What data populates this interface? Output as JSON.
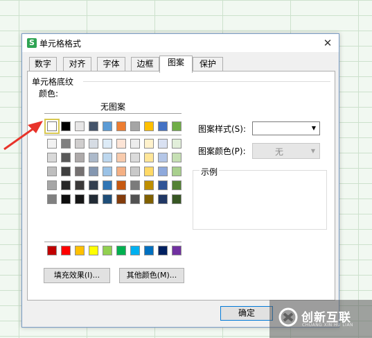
{
  "dialog": {
    "title": "单元格格式",
    "app_icon": "S",
    "close_glyph": "✕"
  },
  "tabs": [
    {
      "label": "数字",
      "active": false
    },
    {
      "label": "对齐",
      "active": false
    },
    {
      "label": "字体",
      "active": false
    },
    {
      "label": "边框",
      "active": false
    },
    {
      "label": "图案",
      "active": true
    },
    {
      "label": "保护",
      "active": false
    }
  ],
  "shading": {
    "section_title": "单元格底纹",
    "color_label": "颜色:",
    "no_pattern_label": "无图案",
    "palette_row1": [
      "#ffffff",
      "#000000",
      "#e7e6e6",
      "#44546a",
      "#5b9bd5",
      "#ed7d31",
      "#a5a5a5",
      "#ffc000",
      "#4472c4",
      "#70ad47"
    ],
    "palette_tints": [
      [
        "#f2f2f2",
        "#7f7f7f",
        "#d0cece",
        "#d6dce4",
        "#ddebf7",
        "#fce4d6",
        "#ededed",
        "#fff2cc",
        "#d9e1f2",
        "#e2efda"
      ],
      [
        "#d9d9d9",
        "#595959",
        "#aeaaaa",
        "#acb9ca",
        "#bdd7ee",
        "#f8cbad",
        "#dbdbdb",
        "#ffe699",
        "#b4c6e7",
        "#c6e0b4"
      ],
      [
        "#bfbfbf",
        "#404040",
        "#757171",
        "#8497b0",
        "#9bc2e6",
        "#f4b084",
        "#c9c9c9",
        "#ffd966",
        "#8ea9db",
        "#a9d08e"
      ],
      [
        "#a6a6a6",
        "#262626",
        "#3a3838",
        "#333f4f",
        "#2f75b5",
        "#c65911",
        "#7b7b7b",
        "#bf8f00",
        "#305496",
        "#548235"
      ],
      [
        "#808080",
        "#0d0d0d",
        "#161616",
        "#222b35",
        "#1f4e78",
        "#833c0c",
        "#525252",
        "#806000",
        "#203764",
        "#375623"
      ]
    ],
    "palette_standard": [
      "#c00000",
      "#ff0000",
      "#ffc000",
      "#ffff00",
      "#92d050",
      "#00b050",
      "#00b0f0",
      "#0070c0",
      "#002060",
      "#7030a0"
    ],
    "selected_color": "#ffffff",
    "fill_effects_button": "填充效果(I)...",
    "more_colors_button": "其他颜色(M)..."
  },
  "pattern": {
    "style_label": "图案样式(S):",
    "style_value": "",
    "color_label": "图案颜色(P):",
    "color_value": "无",
    "example_label": "示例"
  },
  "footer": {
    "ok_label": "确定"
  },
  "annotation": {
    "arrow_color": "#e8332a"
  },
  "watermark": {
    "brand": "创新互联",
    "sub": "CHUANG XIN HU LIAN"
  }
}
